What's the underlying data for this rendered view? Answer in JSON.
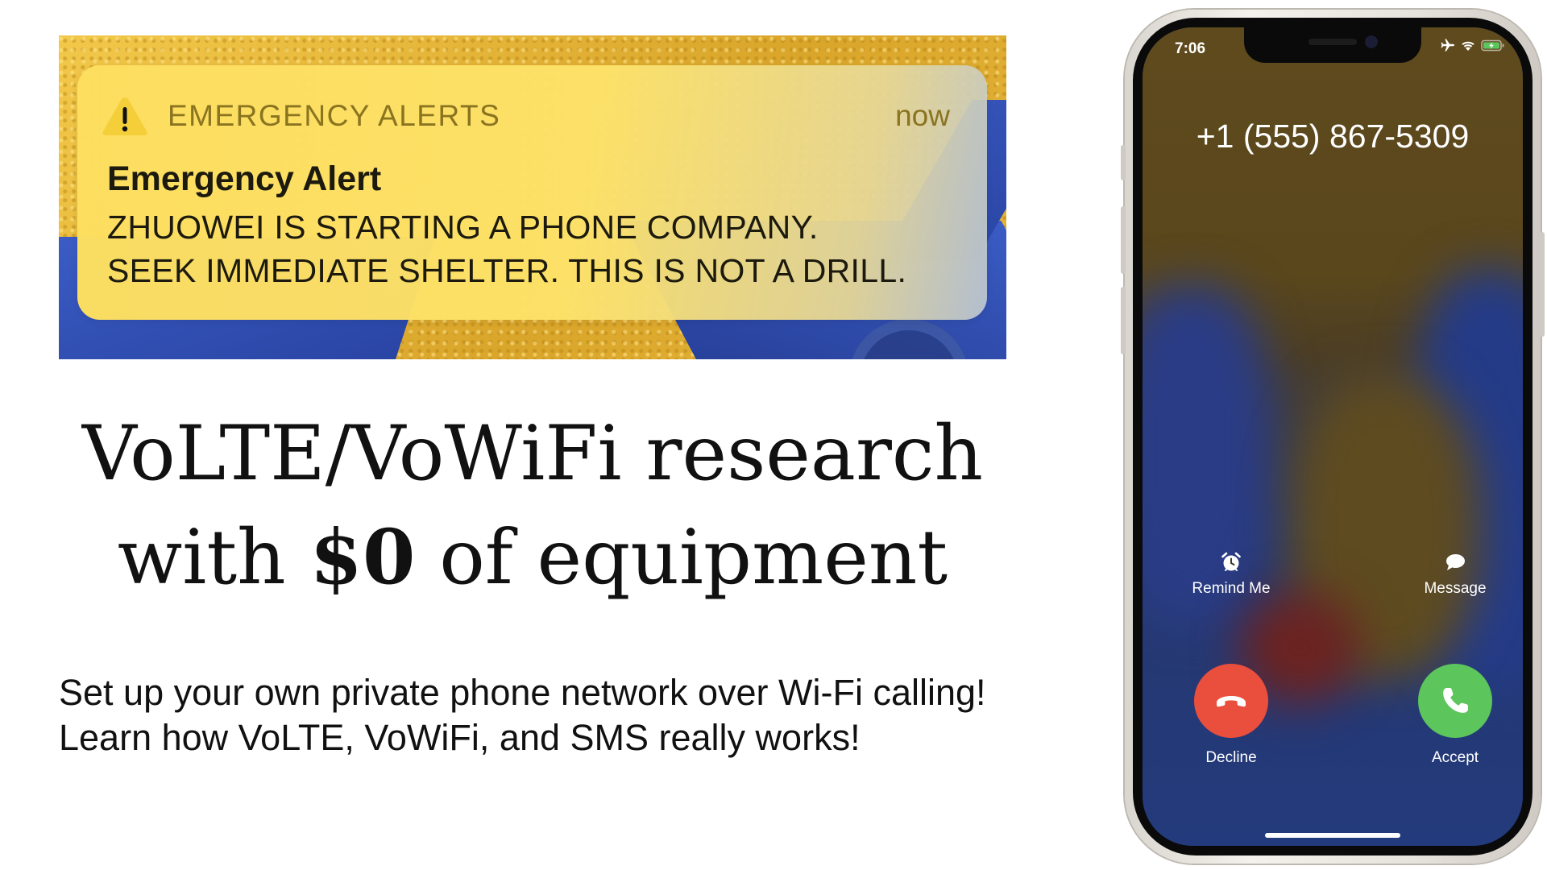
{
  "alert_banner": {
    "app_name": "EMERGENCY ALERTS",
    "time": "now",
    "title": "Emergency Alert",
    "body_lines": [
      "ZHUOWEI IS STARTING A PHONE COMPANY.",
      "SEEK IMMEDIATE SHELTER. THIS IS NOT A DRILL."
    ],
    "icon": "warning-triangle-icon",
    "accent_color": "#fddf63"
  },
  "headline": {
    "line1": "VoLTE/VoWiFi research",
    "line2_prefix": "with",
    "line2_bold": "$0",
    "line2_suffix": "of equipment"
  },
  "subtext": {
    "line1": "Set up your own private phone network over Wi-Fi calling!",
    "line2": "Learn how VoLTE, VoWiFi, and SMS really works!"
  },
  "phone": {
    "status_time": "7:06",
    "status_icons": [
      "airplane-icon",
      "wifi-icon",
      "battery-charging-icon"
    ],
    "caller": "+1 (555) 867-5309",
    "remind_label": "Remind Me",
    "message_label": "Message",
    "decline_label": "Decline",
    "accept_label": "Accept",
    "decline_color": "#ea4e3d",
    "accept_color": "#5cc55c"
  }
}
